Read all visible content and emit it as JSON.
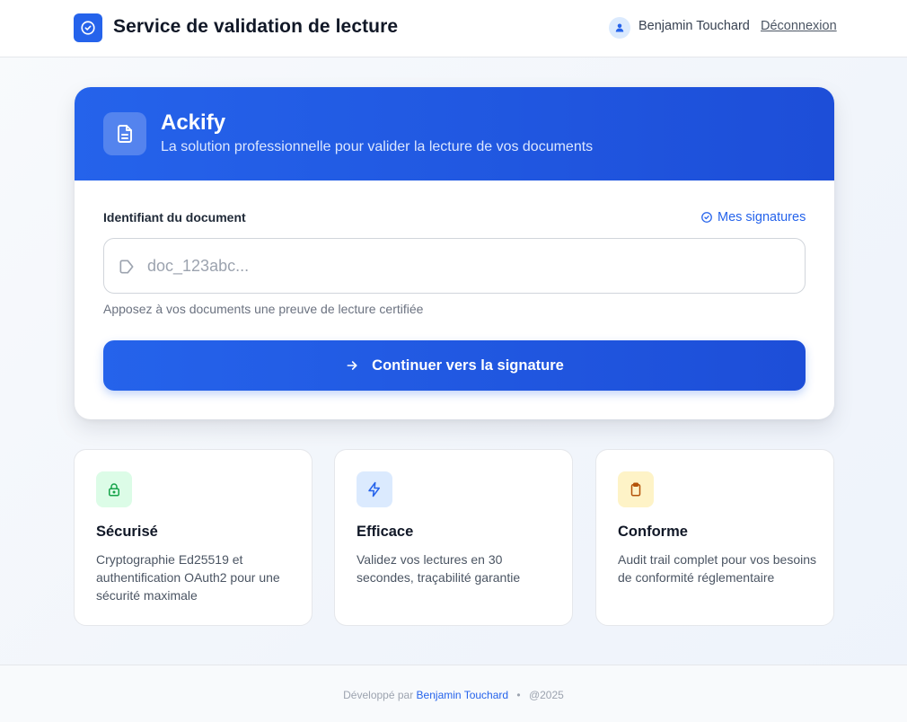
{
  "header": {
    "title": "Service de validation de lecture",
    "user_name": "Benjamin Touchard",
    "logout_label": "Déconnexion"
  },
  "hero": {
    "title": "Ackify",
    "subtitle": "La solution professionnelle pour valider la lecture de vos documents"
  },
  "form": {
    "label": "Identifiant du document",
    "my_signatures_label": "Mes signatures",
    "input_value": "",
    "input_placeholder": "doc_123abc...",
    "helper_text": "Apposez à vos documents une preuve de lecture certifiée",
    "submit_label": "Continuer vers la signature"
  },
  "features": [
    {
      "icon": "lock-icon",
      "title": "Sécurisé",
      "description": "Cryptographie Ed25519 et authentification OAuth2 pour une sécurité maximale",
      "icon_color": "#16a34a",
      "icon_bg": "#dcfce7"
    },
    {
      "icon": "lightning-icon",
      "title": "Efficace",
      "description": "Validez vos lectures en 30 secondes, traçabilité garantie",
      "icon_color": "#2563eb",
      "icon_bg": "#dbeafe"
    },
    {
      "icon": "clipboard-icon",
      "title": "Conforme",
      "description": "Audit trail complet pour vos besoins de conformité réglementaire",
      "icon_color": "#b45309",
      "icon_bg": "#fef3c7"
    }
  ],
  "footer": {
    "prefix": "Développé par",
    "author": "Benjamin Touchard",
    "separator": "•",
    "year": "@2025"
  },
  "colors": {
    "primary": "#2563eb",
    "primary_dark": "#1d4ed8",
    "text": "#111827",
    "muted": "#6b7280"
  }
}
